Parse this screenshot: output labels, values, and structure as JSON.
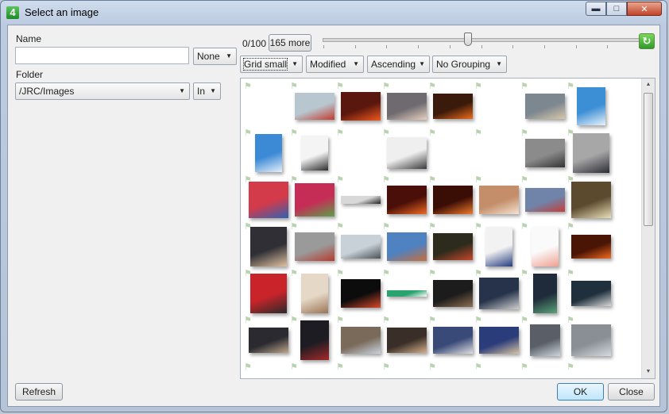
{
  "window": {
    "title": "Select an image",
    "app_icon": "4"
  },
  "left": {
    "name_label": "Name",
    "name_value": "",
    "name_mode": "None",
    "folder_label": "Folder",
    "folder_value": "/JRC/Images",
    "folder_mode": "In",
    "refresh_label": "Refresh"
  },
  "toolbar": {
    "count_text": "0/100",
    "more_label": "165 more",
    "view_mode": "Grid small",
    "sort_field": "Modified",
    "sort_order": "Ascending",
    "grouping": "No Grouping"
  },
  "footer": {
    "ok_label": "OK",
    "close_label": "Close"
  },
  "thumbnails": [
    {
      "r": 0,
      "c": 1,
      "w": 50,
      "h": 34,
      "color": "#b7c6cf",
      "accent": "#c43a2d"
    },
    {
      "r": 0,
      "c": 2,
      "w": 50,
      "h": 36,
      "color": "#5a170d",
      "accent": "#f15a1e"
    },
    {
      "r": 0,
      "c": 3,
      "w": 50,
      "h": 34,
      "color": "#6e6a6f",
      "accent": "#e8d0c0"
    },
    {
      "r": 0,
      "c": 4,
      "w": 50,
      "h": 32,
      "color": "#3a1a0a",
      "accent": "#ee6b1b"
    },
    {
      "r": 0,
      "c": 6,
      "w": 50,
      "h": 32,
      "color": "#7d8790",
      "accent": "#d9c8a8"
    },
    {
      "r": 0,
      "c": 7,
      "w": 36,
      "h": 48,
      "color": "#3d8fd5",
      "accent": "#e9f2fb"
    },
    {
      "r": 1,
      "c": 0,
      "w": 34,
      "h": 48,
      "color": "#3c8ad6",
      "accent": "#e6f0fa"
    },
    {
      "r": 1,
      "c": 1,
      "w": 34,
      "h": 44,
      "color": "#f4f4f4",
      "accent": "#2b2b2b"
    },
    {
      "r": 1,
      "c": 3,
      "w": 50,
      "h": 40,
      "color": "#efefef",
      "accent": "#3a3a3a"
    },
    {
      "r": 1,
      "c": 6,
      "w": 50,
      "h": 36,
      "color": "#8b8b8b",
      "accent": "#333333"
    },
    {
      "r": 1,
      "c": 7,
      "w": 46,
      "h": 50,
      "color": "#a7a7a7",
      "accent": "#2c2c36"
    },
    {
      "r": 2,
      "c": 0,
      "w": 50,
      "h": 46,
      "color": "#d33a4a",
      "accent": "#2f62b3"
    },
    {
      "r": 2,
      "c": 1,
      "w": 50,
      "h": 42,
      "color": "#c62d56",
      "accent": "#5da04a"
    },
    {
      "r": 2,
      "c": 2,
      "w": 50,
      "h": 10,
      "color": "#d8d8d8",
      "accent": "#222222"
    },
    {
      "r": 2,
      "c": 3,
      "w": 50,
      "h": 36,
      "color": "#4a0f08",
      "accent": "#f26a22"
    },
    {
      "r": 2,
      "c": 4,
      "w": 50,
      "h": 36,
      "color": "#3a0d05",
      "accent": "#f07a2c"
    },
    {
      "r": 2,
      "c": 5,
      "w": 50,
      "h": 36,
      "color": "#c48e6a",
      "accent": "#f3e3d3"
    },
    {
      "r": 2,
      "c": 6,
      "w": 50,
      "h": 30,
      "color": "#6f84a8",
      "accent": "#c73c3a"
    },
    {
      "r": 2,
      "c": 7,
      "w": 50,
      "h": 46,
      "color": "#5c4a2f",
      "accent": "#e8e0b6"
    },
    {
      "r": 3,
      "c": 0,
      "w": 46,
      "h": 50,
      "color": "#2f2f35",
      "accent": "#e0c2a0"
    },
    {
      "r": 3,
      "c": 1,
      "w": 50,
      "h": 36,
      "color": "#9a9a9a",
      "accent": "#b73a2d"
    },
    {
      "r": 3,
      "c": 2,
      "w": 50,
      "h": 30,
      "color": "#c8d0d8",
      "accent": "#4b5358"
    },
    {
      "r": 3,
      "c": 3,
      "w": 50,
      "h": 36,
      "color": "#4f82c1",
      "accent": "#c76e3c"
    },
    {
      "r": 3,
      "c": 4,
      "w": 50,
      "h": 34,
      "color": "#2d2b1c",
      "accent": "#c8482a"
    },
    {
      "r": 3,
      "c": 5,
      "w": 34,
      "h": 50,
      "color": "#f2f2f2",
      "accent": "#253d80"
    },
    {
      "r": 3,
      "c": 6,
      "w": 34,
      "h": 50,
      "color": "#fafafa",
      "accent": "#f0a090"
    },
    {
      "r": 3,
      "c": 7,
      "w": 50,
      "h": 30,
      "color": "#4a1505",
      "accent": "#f36a1e"
    },
    {
      "r": 4,
      "c": 0,
      "w": 46,
      "h": 50,
      "color": "#c8242a",
      "accent": "#2a2a2a"
    },
    {
      "r": 4,
      "c": 1,
      "w": 34,
      "h": 50,
      "color": "#e5d8c6",
      "accent": "#9c7455"
    },
    {
      "r": 4,
      "c": 2,
      "w": 50,
      "h": 36,
      "color": "#0c0c0c",
      "accent": "#d9492b"
    },
    {
      "r": 4,
      "c": 3,
      "w": 50,
      "h": 8,
      "color": "#2ba36e",
      "accent": "#ffffff"
    },
    {
      "r": 4,
      "c": 4,
      "w": 50,
      "h": 34,
      "color": "#1c1c1c",
      "accent": "#8f6f52"
    },
    {
      "r": 4,
      "c": 5,
      "w": 50,
      "h": 40,
      "color": "#26334a",
      "accent": "#cfcfcf"
    },
    {
      "r": 4,
      "c": 6,
      "w": 30,
      "h": 50,
      "color": "#1f2a3a",
      "accent": "#5ba37a"
    },
    {
      "r": 4,
      "c": 7,
      "w": 50,
      "h": 32,
      "color": "#1f2f3c",
      "accent": "#d7d7d7"
    },
    {
      "r": 5,
      "c": 0,
      "w": 50,
      "h": 32,
      "color": "#2a2a30",
      "accent": "#bfa78c"
    },
    {
      "r": 5,
      "c": 1,
      "w": 36,
      "h": 50,
      "color": "#1c1c22",
      "accent": "#a52a2a"
    },
    {
      "r": 5,
      "c": 2,
      "w": 50,
      "h": 34,
      "color": "#7a6a5a",
      "accent": "#c8d4e0"
    },
    {
      "r": 5,
      "c": 3,
      "w": 50,
      "h": 32,
      "color": "#3a2f28",
      "accent": "#d4b08a"
    },
    {
      "r": 5,
      "c": 4,
      "w": 50,
      "h": 34,
      "color": "#3a4a78",
      "accent": "#e0e0e0"
    },
    {
      "r": 5,
      "c": 5,
      "w": 50,
      "h": 34,
      "color": "#2a3c7a",
      "accent": "#d8c2a0"
    },
    {
      "r": 5,
      "c": 6,
      "w": 38,
      "h": 40,
      "color": "#5a5f67",
      "accent": "#cfd6dd"
    },
    {
      "r": 5,
      "c": 7,
      "w": 50,
      "h": 40,
      "color": "#8a8f96",
      "accent": "#d6dbe0"
    },
    {
      "r": 6,
      "c": 0,
      "w": 30,
      "h": 20,
      "color": "#0a0a0a",
      "accent": "#ffffff"
    },
    {
      "r": 6,
      "c": 1,
      "w": 30,
      "h": 20,
      "color": "#0a0a0a",
      "accent": "#ffffff"
    },
    {
      "r": 6,
      "c": 2,
      "w": 40,
      "h": 20,
      "color": "#c8a890",
      "accent": "#3a3a3a"
    },
    {
      "r": 6,
      "c": 3,
      "w": 50,
      "h": 20,
      "color": "#9aa0a8",
      "accent": "#d0d0d0"
    },
    {
      "r": 6,
      "c": 4,
      "w": 34,
      "h": 20,
      "color": "#2e5fa8",
      "accent": "#e0e8f0"
    },
    {
      "r": 6,
      "c": 6,
      "w": 50,
      "h": 20,
      "color": "#2a1a3a",
      "accent": "#c06080"
    },
    {
      "r": 6,
      "c": 7,
      "w": 50,
      "h": 20,
      "color": "#0f0f12",
      "accent": "#d8a060"
    }
  ]
}
